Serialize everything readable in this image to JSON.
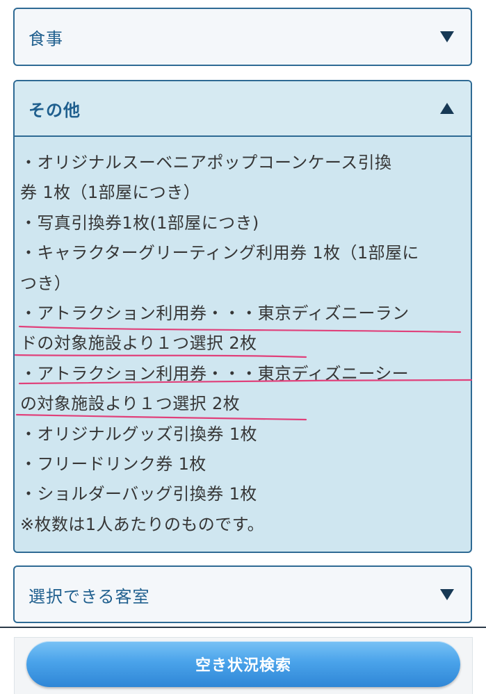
{
  "sections": {
    "meal": {
      "title": "食事",
      "state": "collapsed"
    },
    "other": {
      "title": "その他",
      "state": "expanded",
      "lines": [
        "・オリジナルスーベニアポップコーンケース引換",
        "券 1枚（1部屋につき）",
        "・写真引換券1枚(1部屋につき)",
        "・キャラクターグリーティング利用券 1枚（1部屋に",
        "つき）",
        "・アトラクション利用券・・・東京ディズニーラン",
        "ドの対象施設より１つ選択 2枚",
        "・アトラクション利用券・・・東京ディズニーシー",
        "の対象施設より１つ選択 2枚",
        "・オリジナルグッズ引換券 1枚",
        "・フリードリンク券 1枚",
        "・ショルダーバッグ引換券 1枚",
        "※枚数は1人あたりのものです。"
      ]
    },
    "rooms": {
      "title": "選択できる客室",
      "state": "collapsed"
    }
  },
  "search_button": {
    "label": "空き状況検索"
  },
  "colors": {
    "accent": "#1f5f8e",
    "border": "#2e6a94",
    "expanded_bg": "#cfe6f0",
    "underline": "#e0407a",
    "button": "#4aa3ea"
  },
  "icons": {
    "collapsed": "triangle-down-icon",
    "expanded": "triangle-up-icon"
  }
}
